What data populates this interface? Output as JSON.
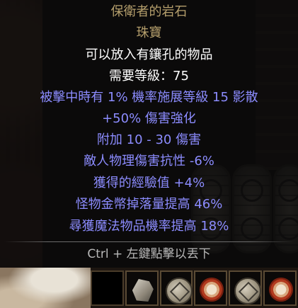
{
  "item": {
    "name": "保衛者的岩石",
    "type": "珠寶",
    "description": "可以放入有鑲孔的物品",
    "requirement": "需要等級：75",
    "mods": [
      "被擊中時有 1% 機率施展等級 15 影散",
      "+50% 傷害強化",
      "附加 10 - 30 傷害",
      "敵人物理傷害抗性 -6%",
      "獲得的經驗值 +4%",
      "怪物金幣掉落量提高 46%",
      "尋獲魔法物品機率提高 18%"
    ],
    "hint": "Ctrl + 左鍵點擊以丟下"
  },
  "colors": {
    "unique": "#b59f6c",
    "magic": "#8c8cff",
    "normal": "#ffffff",
    "hint": "#b8b8b8"
  },
  "slots": [
    {
      "icon": "empty-slot"
    },
    {
      "icon": "rock-icon"
    },
    {
      "icon": "rune-disc-icon"
    },
    {
      "icon": "red-scroll-icon"
    },
    {
      "icon": "rune-disc-icon"
    },
    {
      "icon": "red-scroll-icon"
    }
  ]
}
